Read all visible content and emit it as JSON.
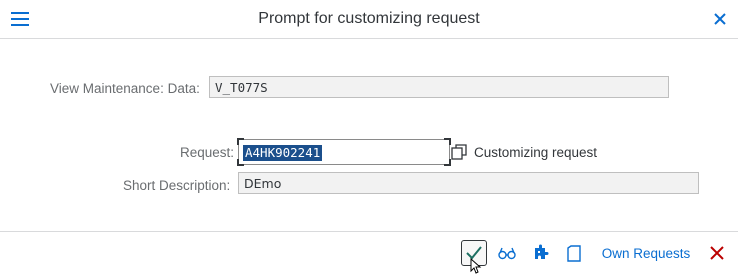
{
  "header": {
    "title": "Prompt for customizing request",
    "menu_icon": "hamburger-menu-icon",
    "close_icon": "close-icon"
  },
  "form": {
    "view_maintenance_label": "View Maintenance: Data:",
    "view_maintenance_value": "V_T077S",
    "request_label": "Request:",
    "request_value": "A4HK902241",
    "request_type": "Customizing request",
    "short_description_label": "Short Description:",
    "short_description_value": "DEmo"
  },
  "toolbar": {
    "own_requests_label": "Own Requests",
    "icons": [
      "checkmark-icon",
      "glasses-icon",
      "puzzle-icon",
      "document-icon",
      "cancel-icon"
    ]
  },
  "colors": {
    "accent": "#0a6ed1",
    "selection": "#1b4f8c",
    "cancel": "#bb0000"
  }
}
